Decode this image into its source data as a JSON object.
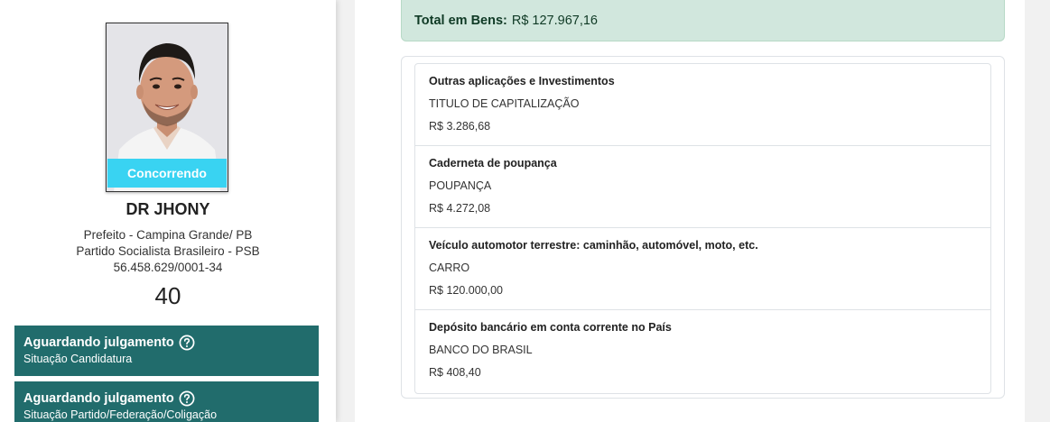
{
  "candidate": {
    "status_chip": "Concorrendo",
    "name": "DR JHONY",
    "office": "Prefeito - Campina Grande/ PB",
    "party": "Partido Socialista Brasileiro - PSB",
    "cnpj": "56.458.629/0001-34",
    "number": "40",
    "photo_icon": "candidate-photo"
  },
  "situations": [
    {
      "title": "Aguardando julgamento",
      "subtitle": "Situação Candidatura",
      "icon": "help-circle-icon"
    },
    {
      "title": "Aguardando julgamento",
      "subtitle": "Situação Partido/Federação/Coligação",
      "icon": "help-circle-icon"
    }
  ],
  "total": {
    "label": "Total em Bens:",
    "value": "R$ 127.967,16"
  },
  "assets": [
    {
      "type": "Outras aplicações e Investimentos",
      "description": "TITULO DE CAPITALIZAÇÃO",
      "value": "R$ 3.286,68"
    },
    {
      "type": "Caderneta de poupança",
      "description": "POUPANÇA",
      "value": "R$ 4.272,08"
    },
    {
      "type": "Veículo automotor terrestre: caminhão, automóvel, moto, etc.",
      "description": "CARRO",
      "value": "R$ 120.000,00"
    },
    {
      "type": "Depósito bancário em conta corrente no País",
      "description": "BANCO DO BRASIL",
      "value": "R$ 408,40"
    }
  ],
  "colors": {
    "status_chip": "#39d3f2",
    "situation_bg": "#216c6c",
    "total_bg": "#d1e7dd"
  }
}
